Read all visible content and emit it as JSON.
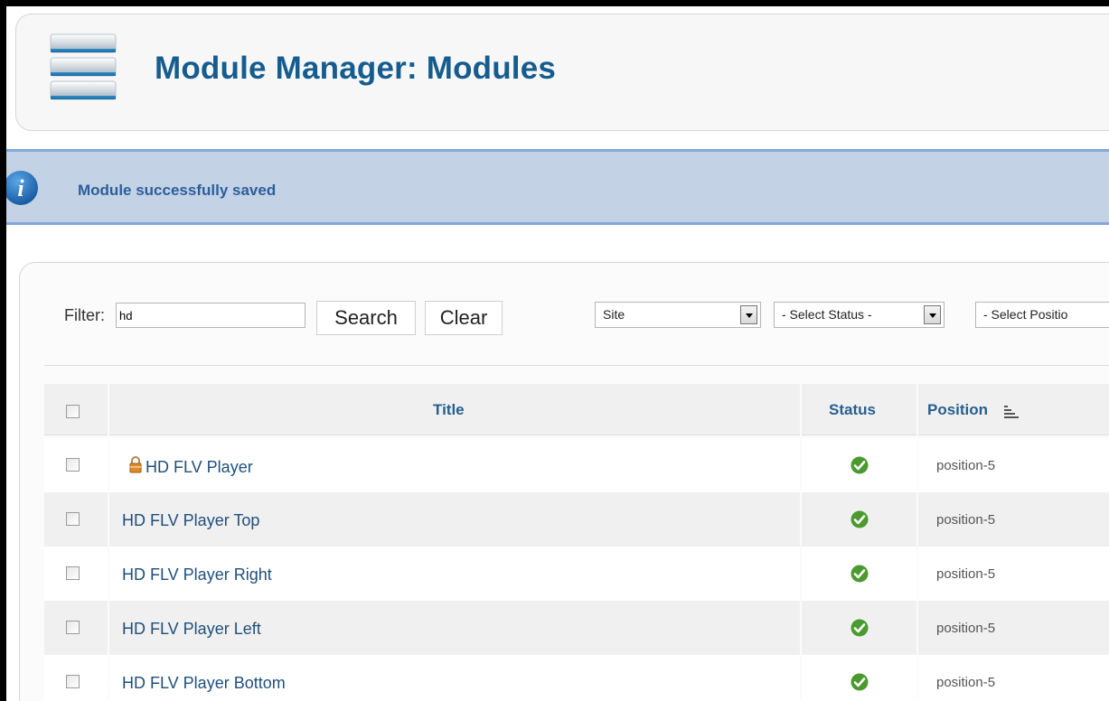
{
  "header": {
    "title": "Module Manager: Modules",
    "icon": "module-manager-icon"
  },
  "message": {
    "icon": "info-icon",
    "text": "Module successfully saved"
  },
  "filter": {
    "label": "Filter:",
    "value": "hd",
    "search_label": "Search",
    "clear_label": "Clear"
  },
  "selects": {
    "client": "Site",
    "status": "- Select Status -",
    "position": "- Select Positio"
  },
  "table": {
    "columns": {
      "title": "Title",
      "status": "Status",
      "position": "Position"
    },
    "rows": [
      {
        "title": "HD FLV Player",
        "locked": true,
        "status": "published",
        "position": "position-5"
      },
      {
        "title": "HD FLV Player Top",
        "locked": false,
        "status": "published",
        "position": "position-5"
      },
      {
        "title": "HD FLV Player Right",
        "locked": false,
        "status": "published",
        "position": "position-5"
      },
      {
        "title": "HD FLV Player Left",
        "locked": false,
        "status": "published",
        "position": "position-5"
      },
      {
        "title": "HD FLV Player Bottom",
        "locked": false,
        "status": "published",
        "position": "position-5"
      }
    ]
  },
  "colors": {
    "title": "#155d8f",
    "message_bg": "#c3d2e5",
    "message_border": "#84a7db",
    "message_text": "#2d5e9c",
    "link": "#1f4f7c",
    "published": "#4a9a2f"
  }
}
